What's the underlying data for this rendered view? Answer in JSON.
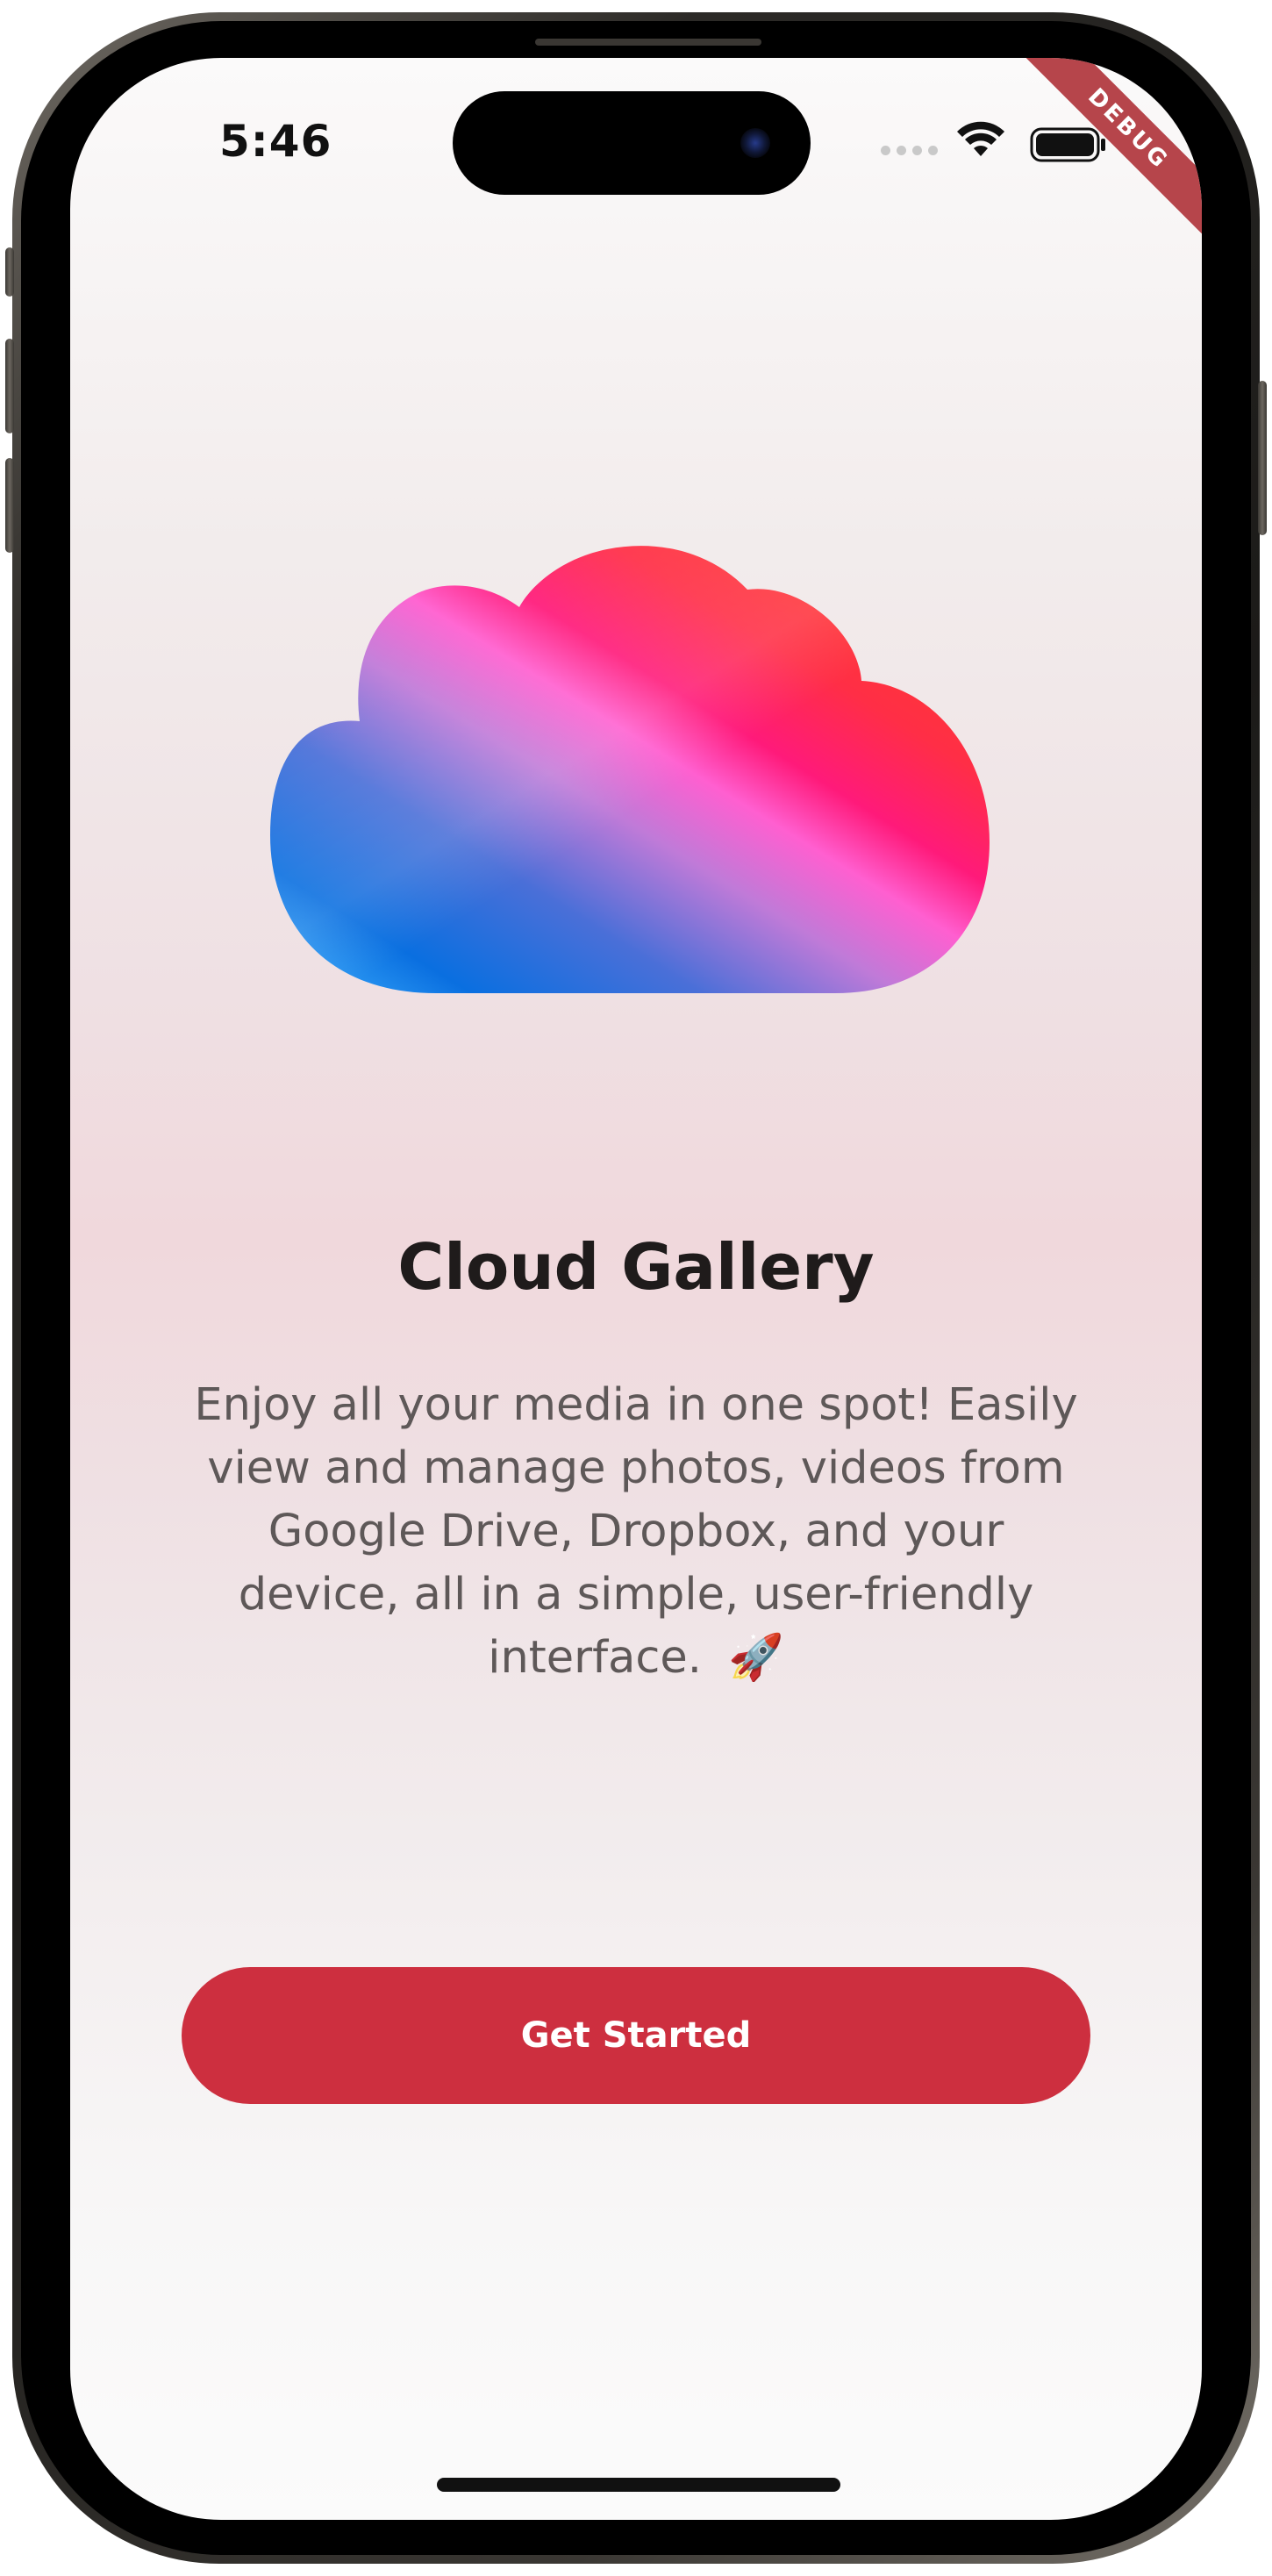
{
  "status_bar": {
    "time": "5:46",
    "wifi_icon": "wifi-icon",
    "battery_icon": "battery-icon",
    "signal_icon": "signal-dots-icon"
  },
  "debug_banner": {
    "label": "DEBUG",
    "color": "#b6454b"
  },
  "hero": {
    "logo_icon": "cloud-icon",
    "logo_colors": [
      "#1f78e6",
      "#8e5fd6",
      "#f25fc8",
      "#ff1f6a",
      "#ff3b30",
      "#ff6a3a"
    ]
  },
  "content": {
    "title": "Cloud Gallery",
    "description": "Enjoy all your media in one spot! Easily view and manage photos, videos from Google Drive, Dropbox, and your device, all in a simple, user-friendly interface.",
    "description_emoji": "🚀"
  },
  "actions": {
    "primary_label": "Get Started",
    "primary_color": "#cd2f3f"
  }
}
